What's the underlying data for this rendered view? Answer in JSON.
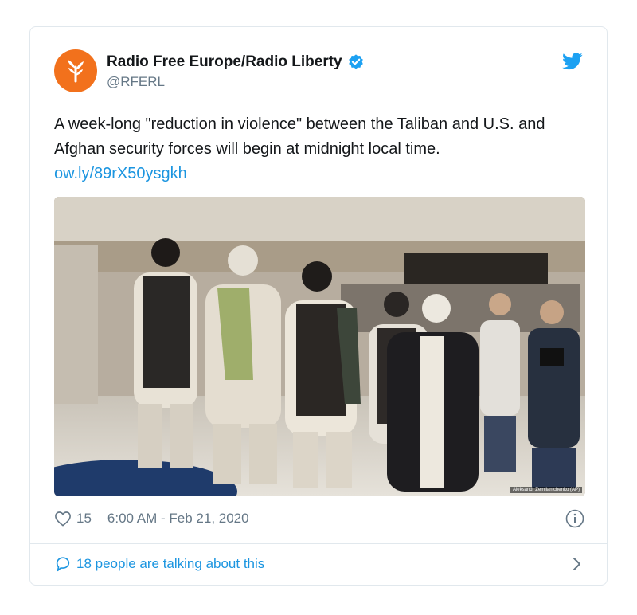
{
  "tweet": {
    "author": {
      "name": "Radio Free Europe/Radio Liberty",
      "handle": "@RFERL",
      "verified": true,
      "avatar_color": "#f2711c"
    },
    "text": "A week-long \"reduction in violence\" between the Taliban and U.S. and Afghan security forces will begin at midnight local time.",
    "link": "ow.ly/89rX50ysgkh",
    "photo": {
      "credit": "Aleksandr Zemlianichenko (AP)"
    },
    "likes": "15",
    "timestamp": "6:00 AM - Feb 21, 2020",
    "conversation": "18 people are talking about this"
  },
  "colors": {
    "accent": "#1b95e0",
    "text": "#14171a",
    "muted": "#657786",
    "border": "#e1e8ed"
  },
  "icons": [
    "rferl-logo-icon",
    "verified-badge-icon",
    "twitter-bird-icon",
    "heart-icon",
    "info-icon",
    "speech-bubble-icon",
    "chevron-right-icon"
  ]
}
